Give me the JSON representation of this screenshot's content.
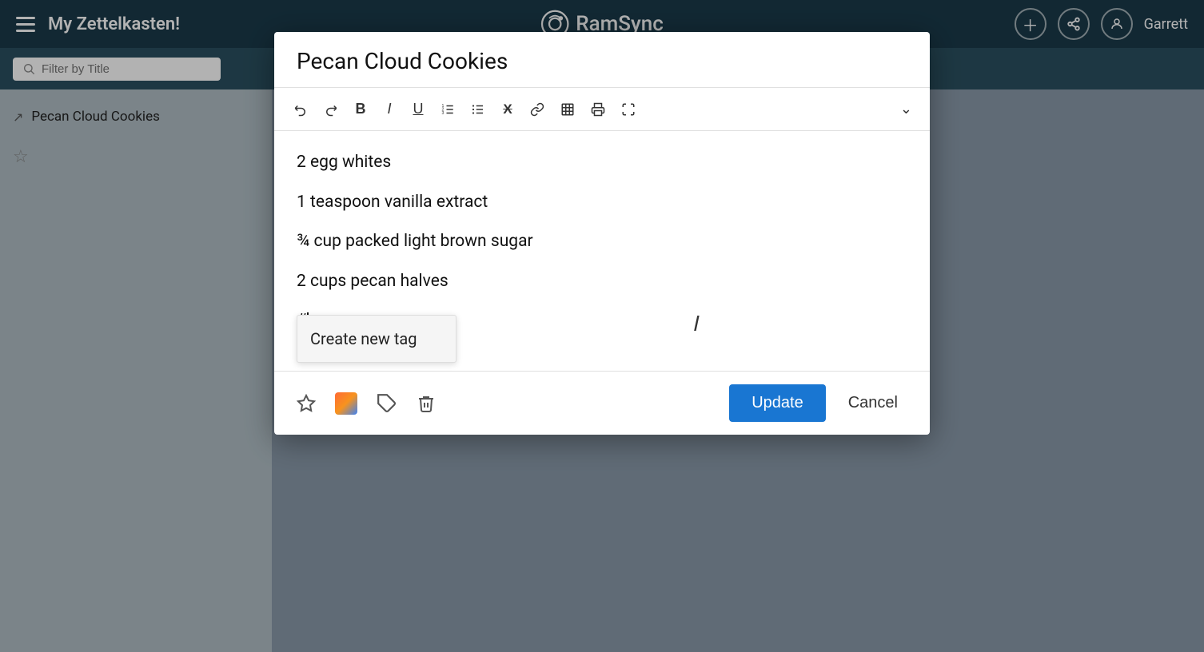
{
  "app": {
    "title": "My Zettelkasten!",
    "brand": "RamSync",
    "user": "Garrett"
  },
  "topbar": {
    "add_label": "+",
    "share_label": "share",
    "user_label": "Garrett"
  },
  "searchbar": {
    "placeholder": "Filter by Title"
  },
  "sidebar": {
    "item1_label": "Pecan Cloud Cookies"
  },
  "modal": {
    "title": "Pecan Cloud Cookies",
    "content": {
      "line1": "2 egg whites",
      "line2": "1 teaspoon vanilla extract",
      "line3": "¾ cup packed light brown sugar",
      "line4": "2 cups pecan halves",
      "line5": "#"
    },
    "tag_dropdown": {
      "item1": "Create new tag"
    },
    "footer": {
      "update_label": "Update",
      "cancel_label": "Cancel"
    }
  },
  "toolbar": {
    "undo": "↩",
    "redo": "↪",
    "bold": "B",
    "italic": "I",
    "underline": "U",
    "ordered_list": "ol",
    "unordered_list": "ul",
    "strikethrough": "X",
    "link": "🔗",
    "table": "⊞",
    "print": "🖨",
    "fullscreen": "⤢",
    "chevron": "⌄"
  }
}
